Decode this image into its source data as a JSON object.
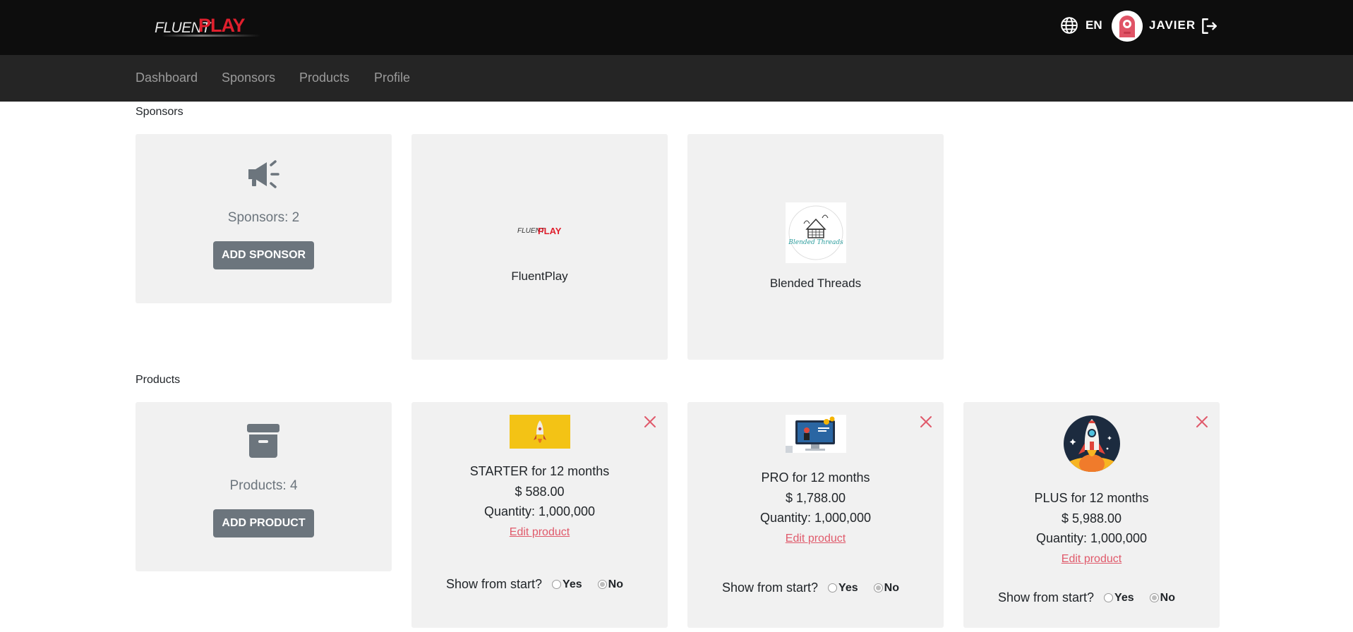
{
  "header": {
    "logo_fluent": "FLUENT",
    "logo_play": "PLAY",
    "language": "EN",
    "user_name": "JAVIER"
  },
  "nav": {
    "items": [
      "Dashboard",
      "Sponsors",
      "Products",
      "Profile"
    ]
  },
  "sponsors": {
    "title": "Sponsors",
    "count_label": "Sponsors: 2",
    "add_button": "ADD SPONSOR",
    "items": [
      {
        "name": "FluentPlay",
        "logo_fluent": "FLUENT",
        "logo_play": "PLAY"
      },
      {
        "name": "Blended Threads",
        "logo_text": "Blended Threads"
      }
    ]
  },
  "products": {
    "title": "Products",
    "count_label": "Products: 4",
    "add_button": "ADD PRODUCT",
    "show_label": "Show from start?",
    "yes_label": "Yes",
    "no_label": "No",
    "edit_label": "Edit product",
    "items": [
      {
        "name": "STARTER for 12 months",
        "price": "$ 588.00",
        "quantity": "Quantity: 1,000,000",
        "show_from_start": "No"
      },
      {
        "name": "PRO for 12 months",
        "price": "$ 1,788.00",
        "quantity": "Quantity: 1,000,000",
        "show_from_start": "No"
      },
      {
        "name": "PLUS for 12 months",
        "price": "$ 5,988.00",
        "quantity": "Quantity: 1,000,000",
        "show_from_start": "No"
      }
    ]
  },
  "colors": {
    "topbar": "#0d0d0d",
    "navbar": "#252525",
    "card": "#f1f1f1",
    "button": "#6c757d",
    "accent_red": "#e05a6b",
    "brand_red": "#e01f2d"
  }
}
